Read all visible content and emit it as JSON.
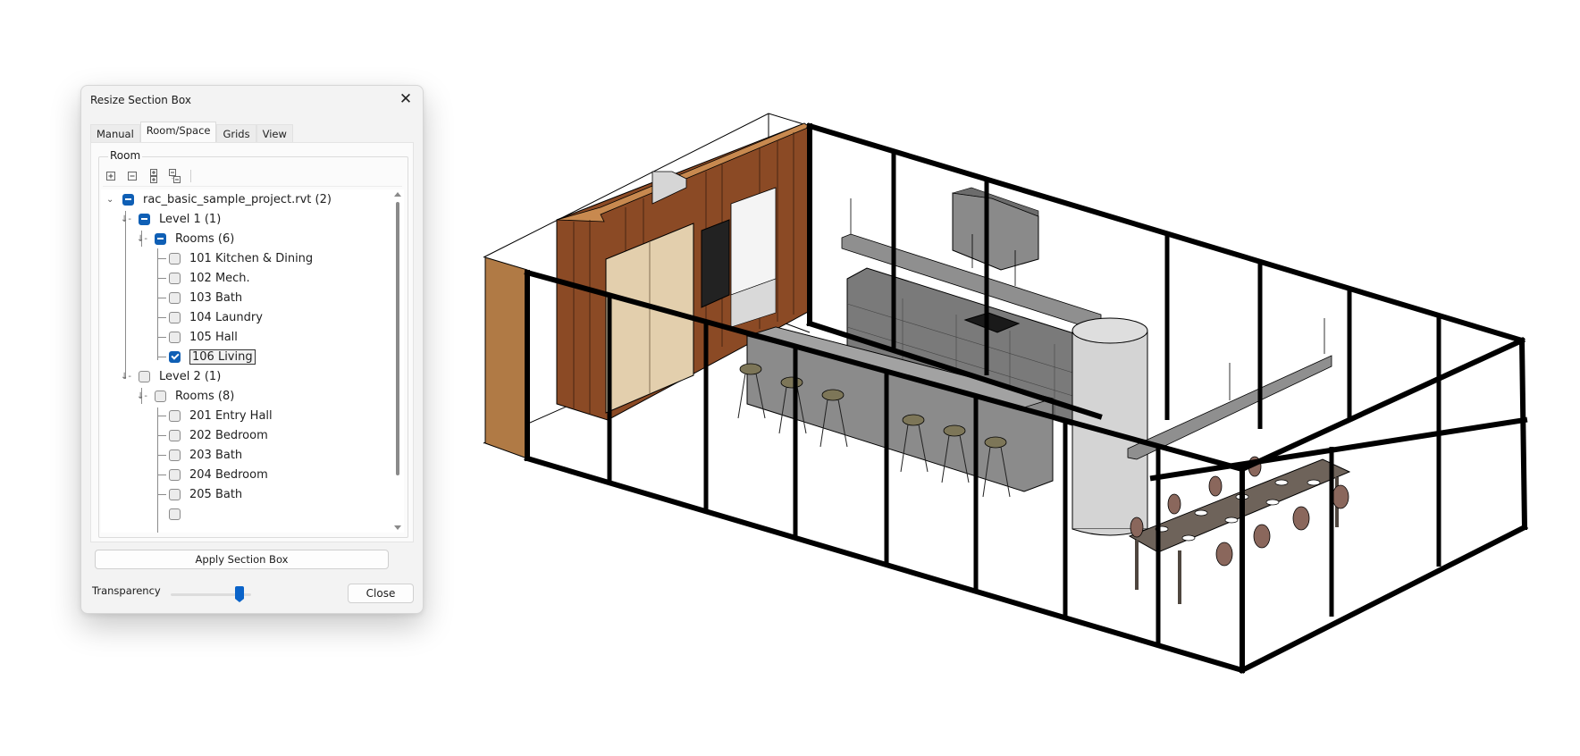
{
  "dialog": {
    "title": "Resize Section Box",
    "close_icon": "close-icon",
    "tabs": [
      {
        "label": "Manual",
        "active": false
      },
      {
        "label": "Room/Space",
        "active": true
      },
      {
        "label": "Grids",
        "active": false
      },
      {
        "label": "View",
        "active": false
      }
    ],
    "group_label": "Room",
    "toolbar_icons": [
      "expand-all-icon",
      "collapse-all-icon",
      "expand-level-icon",
      "collapse-level-icon"
    ],
    "tree": {
      "root": {
        "label": "rac_basic_sample_project.rvt (2)",
        "state": "indeterminate",
        "expanded": true
      },
      "levels": [
        {
          "label": "Level 1 (1)",
          "state": "indeterminate",
          "group": {
            "label": "Rooms (6)",
            "state": "indeterminate"
          },
          "rooms": [
            {
              "label": "101 Kitchen & Dining",
              "checked": false
            },
            {
              "label": "102 Mech.",
              "checked": false
            },
            {
              "label": "103 Bath",
              "checked": false
            },
            {
              "label": "104 Laundry",
              "checked": false
            },
            {
              "label": "105 Hall",
              "checked": false
            },
            {
              "label": "106 Living",
              "checked": true,
              "focused": true
            }
          ]
        },
        {
          "label": "Level 2 (1)",
          "state": "unchecked",
          "group": {
            "label": "Rooms (8)",
            "state": "unchecked"
          },
          "rooms": [
            {
              "label": "201 Entry Hall",
              "checked": false
            },
            {
              "label": "202 Bedroom",
              "checked": false
            },
            {
              "label": "203 Bath",
              "checked": false
            },
            {
              "label": "204 Bedroom",
              "checked": false
            },
            {
              "label": "205 Bath",
              "checked": false
            }
          ]
        }
      ]
    },
    "apply_button": "Apply Section Box",
    "transparency_label": "Transparency",
    "transparency_value": 0.85,
    "close_button": "Close"
  },
  "viewport": {
    "description": "3D isometric view of section box around kitchen and dining room",
    "colors": {
      "edge": "#000000",
      "wood_wall": "#8b4a25",
      "light_wood": "#e3cfad",
      "side_panel": "#b07a45",
      "cabinet_gray": "#8a8a8a",
      "concrete": "#d4d4d4",
      "table": "#6e635a",
      "chair": "#8a675c"
    }
  }
}
